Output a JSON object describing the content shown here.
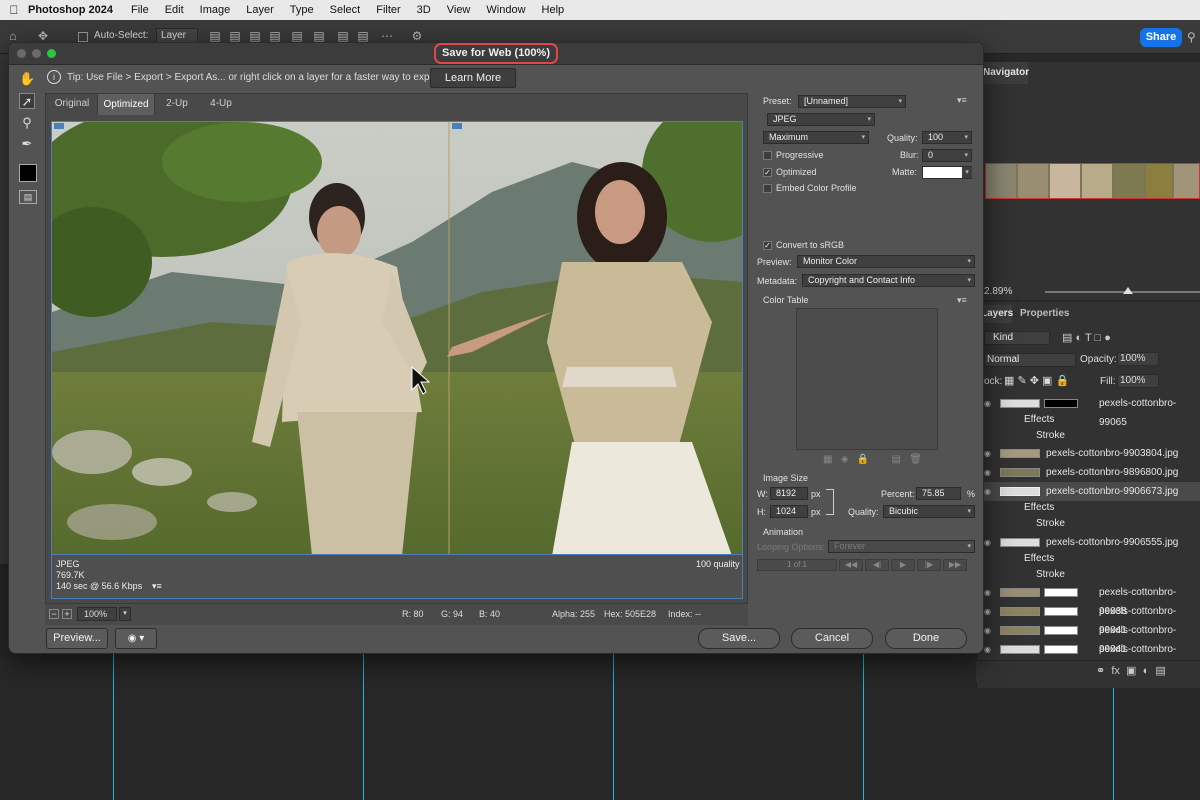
{
  "menubar": {
    "app": "Photoshop 2024",
    "items": [
      "File",
      "Edit",
      "Image",
      "Layer",
      "Type",
      "Select",
      "Filter",
      "3D",
      "View",
      "Window",
      "Help"
    ]
  },
  "options": {
    "auto_select_label": "Auto-Select:",
    "auto_select_value": "Layer",
    "share_label": "Share"
  },
  "dialog": {
    "title": "Save for Web (100%)",
    "tip": "Tip: Use File > Export > Export As...  or right click on a layer for a faster way to export assets",
    "learn_more": "Learn More",
    "tabs": [
      "Original",
      "Optimized",
      "2-Up",
      "4-Up"
    ],
    "active_tab": "Optimized",
    "image_info": {
      "format": "JPEG",
      "size": "769.7K",
      "time": "140 sec @ 56.6 Kbps",
      "quality": "100 quality"
    },
    "statusbar": {
      "zoom": "100%",
      "r": "R: 80",
      "g": "G: 94",
      "b": "B: 40",
      "alpha": "Alpha: 255",
      "hex": "Hex: 505E28",
      "index": "Index: --"
    },
    "buttons": {
      "preview": "Preview...",
      "save": "Save...",
      "cancel": "Cancel",
      "done": "Done"
    },
    "settings": {
      "preset_label": "Preset:",
      "preset_value": "[Unnamed]",
      "format_value": "JPEG",
      "compression_value": "Maximum",
      "quality_label": "Quality:",
      "quality_value": "100",
      "progressive_label": "Progressive",
      "progressive_checked": false,
      "blur_label": "Blur:",
      "blur_value": "0",
      "optimized_label": "Optimized",
      "optimized_checked": true,
      "matte_label": "Matte:",
      "embed_label": "Embed Color Profile",
      "embed_checked": false,
      "srgb_label": "Convert to sRGB",
      "srgb_checked": true,
      "preview_label": "Preview:",
      "preview_value": "Monitor Color",
      "metadata_label": "Metadata:",
      "metadata_value": "Copyright and Contact Info",
      "color_table_label": "Color Table",
      "image_size_label": "Image Size",
      "w_label": "W:",
      "w_value": "8192",
      "h_label": "H:",
      "h_value": "1024",
      "unit": "px",
      "percent_label": "Percent:",
      "percent_value": "75.85",
      "percent_unit": "%",
      "quality_resample_label": "Quality:",
      "quality_resample_value": "Bicubic",
      "animation_label": "Animation",
      "looping_label": "Looping Options:",
      "looping_value": "Forever",
      "frame_counter": "1 of 1"
    }
  },
  "navigator": {
    "tab": "Navigator",
    "zoom": "2.89%"
  },
  "layers": {
    "tabs": [
      "Layers",
      "Properties"
    ],
    "kind_label": "Kind",
    "blend_mode": "Normal",
    "opacity_label": "Opacity:",
    "opacity_value": "100%",
    "lock_label": "ock:",
    "fill_label": "Fill:",
    "fill_value": "100%",
    "rows": [
      {
        "name": "pexels-cottonbro-99065"
      },
      {
        "name": "Effects"
      },
      {
        "name": "Stroke"
      },
      {
        "name": "pexels-cottonbro-9903804.jpg"
      },
      {
        "name": "pexels-cottonbro-9896800.jpg"
      },
      {
        "name": "pexels-cottonbro-9906673.jpg"
      },
      {
        "name": "Effects"
      },
      {
        "name": "Stroke"
      },
      {
        "name": "pexels-cottonbro-9906555.jpg"
      },
      {
        "name": "Effects"
      },
      {
        "name": "Stroke"
      },
      {
        "name": "pexels-cottonbro-99038"
      },
      {
        "name": "pexels-cottonbro-99041"
      },
      {
        "name": "pexels-cottonbro-99041"
      },
      {
        "name": "pexels-cottonbro-99041"
      }
    ]
  }
}
